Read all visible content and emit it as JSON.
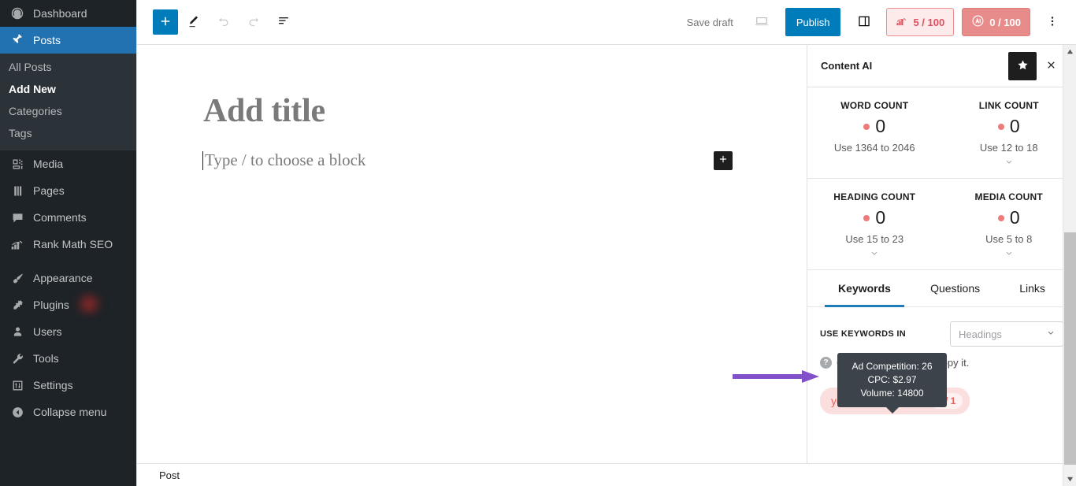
{
  "admin_sidebar": {
    "items": [
      {
        "label": "Dashboard",
        "icon": "dashboard-icon",
        "current": false
      },
      {
        "label": "Posts",
        "icon": "pin-icon",
        "current": true
      },
      {
        "label": "Media",
        "icon": "media-icon",
        "current": false
      },
      {
        "label": "Pages",
        "icon": "pages-icon",
        "current": false
      },
      {
        "label": "Comments",
        "icon": "comments-icon",
        "current": false
      },
      {
        "label": "Rank Math SEO",
        "icon": "rankmath-icon",
        "current": false
      },
      {
        "label": "Appearance",
        "icon": "brush-icon",
        "current": false
      },
      {
        "label": "Plugins",
        "icon": "plug-icon",
        "current": false,
        "badge": true
      },
      {
        "label": "Users",
        "icon": "user-icon",
        "current": false
      },
      {
        "label": "Tools",
        "icon": "wrench-icon",
        "current": false
      },
      {
        "label": "Settings",
        "icon": "settings-icon",
        "current": false
      },
      {
        "label": "Collapse menu",
        "icon": "collapse-icon",
        "current": false
      }
    ],
    "posts_submenu": [
      {
        "label": "All Posts",
        "current": false
      },
      {
        "label": "Add New",
        "current": true
      },
      {
        "label": "Categories",
        "current": false
      },
      {
        "label": "Tags",
        "current": false
      }
    ]
  },
  "toolbar": {
    "inserter_icon": "plus-icon",
    "tools_icon": "pencil-icon",
    "undo_icon": "undo-icon",
    "redo_icon": "redo-icon",
    "list_view_icon": "list-view-icon",
    "save_draft_label": "Save draft",
    "preview_icon": "preview-icon",
    "publish_label": "Publish",
    "settings_icon": "sidebar-toggle-icon",
    "seo_score": {
      "icon": "rankmath-score-icon",
      "label": "5 / 100",
      "bg": "#fdeaea",
      "border": "#ec8d8d",
      "color": "#e04f5f"
    },
    "ai_score": {
      "icon": "content-ai-icon",
      "label": "0 / 100",
      "bg": "#e88b8b",
      "border": "#e07c7c",
      "color": "#ffffff"
    },
    "more_icon": "kebab-menu-icon"
  },
  "editor": {
    "title_placeholder": "Add title",
    "block_placeholder": "Type / to choose a block",
    "appender_icon": "plus-icon",
    "breadcrumb": "Post"
  },
  "content_ai": {
    "panel_title": "Content AI",
    "star_icon": "star-icon",
    "close_icon": "close-icon",
    "stats": [
      {
        "label": "WORD COUNT",
        "value": "0",
        "hint": "Use 1364 to 2046",
        "dot_color": "#ef7a7a",
        "has_chevron": false
      },
      {
        "label": "LINK COUNT",
        "value": "0",
        "hint": "Use 12 to 18",
        "dot_color": "#ef7a7a",
        "has_chevron": true
      },
      {
        "label": "HEADING COUNT",
        "value": "0",
        "hint": "Use 15 to 23",
        "dot_color": "#ef7a7a",
        "has_chevron": true
      },
      {
        "label": "MEDIA COUNT",
        "value": "0",
        "hint": "Use 5 to 8",
        "dot_color": "#ef7a7a",
        "has_chevron": true
      }
    ],
    "tabs": [
      {
        "label": "Keywords",
        "active": true
      },
      {
        "label": "Questions",
        "active": false
      },
      {
        "label": "Links",
        "active": false
      }
    ],
    "keywords_section": {
      "use_label": "USE KEYWORDS IN",
      "select_value": "Headings",
      "select_chevron_icon": "chevron-down-icon",
      "help_icon": "help-icon",
      "note": "Click on a keyword to copy it.",
      "keywords": [
        {
          "text": "yoga for beginners",
          "count": "0 / 1"
        }
      ]
    },
    "tooltip": {
      "lines": [
        "Ad Competition: 26",
        "CPC: $2.97",
        "Volume: 14800"
      ]
    },
    "active_tab_color": "#1e7cb8"
  },
  "annotation": {
    "arrow_color": "#8250c8"
  }
}
